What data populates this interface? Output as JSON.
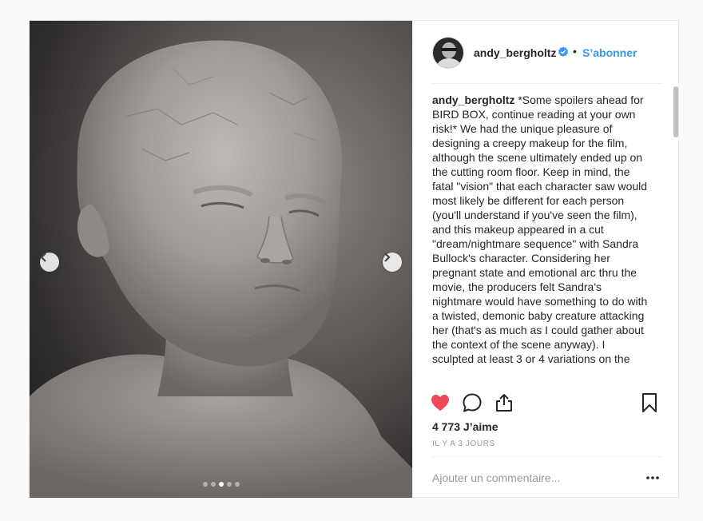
{
  "post": {
    "user": {
      "username": "andy_bergholtz",
      "verified_icon": "verified-badge-icon",
      "verified_color": "#3897f0"
    },
    "separator": "•",
    "follow_label": "S’abonner",
    "caption": {
      "username": "andy_bergholtz",
      "text": " *Some spoilers ahead for BIRD BOX, continue reading at your own risk!* We had the unique pleasure of designing a creepy makeup for the film, although the scene ultimately ended up on the cutting room floor. Keep in mind, the fatal \"vision\" that each character saw would most likely be different for each person (you'll understand if you've seen the film), and this makeup appeared in a cut \"dream/nightmare sequence\" with Sandra Bullock's character. Considering her pregnant state and emotional arc thru the movie, the producers felt Sandra's nightmare would have something to do with a twisted, demonic baby creature attacking her (that's as much as I could gather about the context of the scene anyway). I sculpted at least 3 or 4 variations on the"
    },
    "actions": {
      "like_icon": "heart-filled-icon",
      "like_color": "#ed4956",
      "comment_icon": "comment-bubble-icon",
      "share_icon": "share-upload-icon",
      "save_icon": "bookmark-icon"
    },
    "likes_label": "4 773 J’aime",
    "timestamp": "IL Y A 3 JOURS",
    "comment": {
      "placeholder": "Ajouter un commentaire...",
      "more_icon": "more-options-icon"
    },
    "carousel": {
      "prev_icon": "chevron-left-icon",
      "next_icon": "chevron-right-icon",
      "dot_count": 5,
      "active_dot": 3
    },
    "colors": {
      "link_blue": "#3897f0",
      "border": "#efefef",
      "muted": "#999999"
    }
  }
}
